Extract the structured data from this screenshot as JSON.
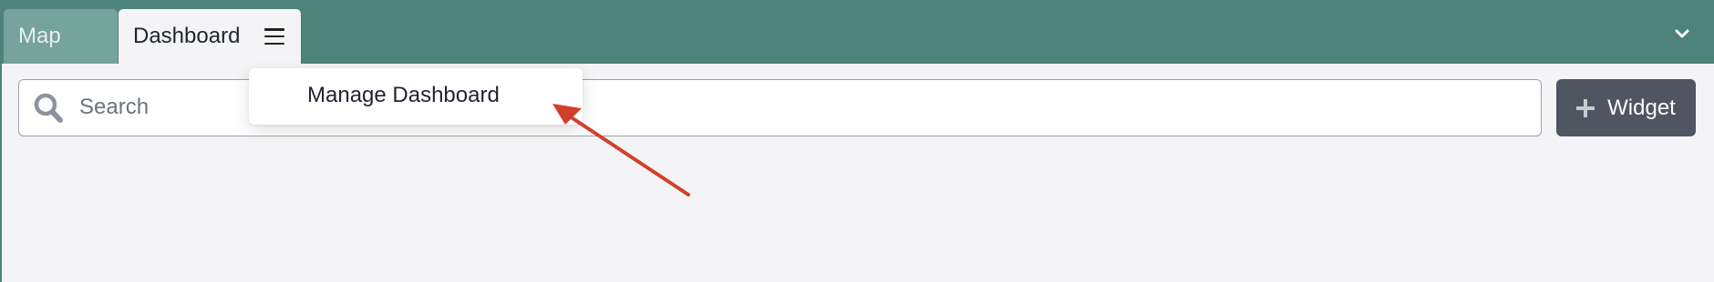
{
  "tabs": [
    {
      "label": "Map",
      "active": false
    },
    {
      "label": "Dashboard",
      "active": true
    }
  ],
  "tab_menu": {
    "items": [
      {
        "label": "Manage Dashboard"
      }
    ]
  },
  "search": {
    "placeholder": "Search",
    "value": ""
  },
  "widget_button": {
    "label": "Widget"
  },
  "icons": {
    "search": "search-icon",
    "menu": "hamburger-menu-icon",
    "collapse": "chevron-down-icon",
    "add": "plus-icon"
  },
  "colors": {
    "header_bg": "#4e837b",
    "inactive_tab_bg": "#76a39b",
    "page_bg": "#f4f4f6",
    "widget_button_bg": "#4f5661",
    "annotation_arrow": "#d1402c"
  }
}
